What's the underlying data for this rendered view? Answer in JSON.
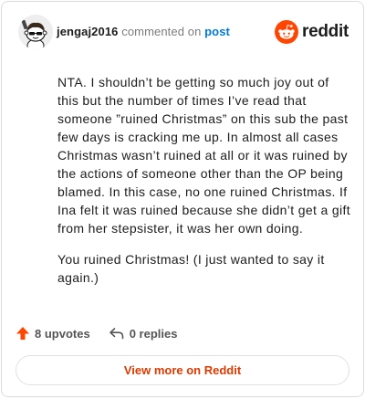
{
  "header": {
    "username": "jengaj2016",
    "commented_text": "commented on",
    "post_link": "post",
    "brand_name": "reddit",
    "avatar_icon": "snoo-avatar-icon",
    "brand_icon": "reddit-logo-icon"
  },
  "comment": {
    "paragraphs": [
      "NTA. I shouldn’t be getting so much joy out of this but the number of times I’ve read that someone ”ruined Christmas” on this sub the past few days is cracking me up. In almost all cases Christmas wasn’t ruined at all or it was ruined by the actions of someone other than the OP being blamed. In this case, no one ruined Christmas. If Ina felt it was ruined because she didn’t get a gift from her stepsister, it was her own doing.",
      "You ruined Christmas! (I just wanted to say it again.)"
    ]
  },
  "footer": {
    "upvotes_label": "8 upvotes",
    "replies_label": "0 replies",
    "upvote_icon": "upvote-arrow-icon",
    "reply_icon": "reply-arrow-icon"
  },
  "view_more_label": "View more on Reddit",
  "colors": {
    "brand": "#ff4500",
    "link": "#0079d3",
    "view_more": "#d93a00",
    "muted": "#7c7c7c"
  }
}
